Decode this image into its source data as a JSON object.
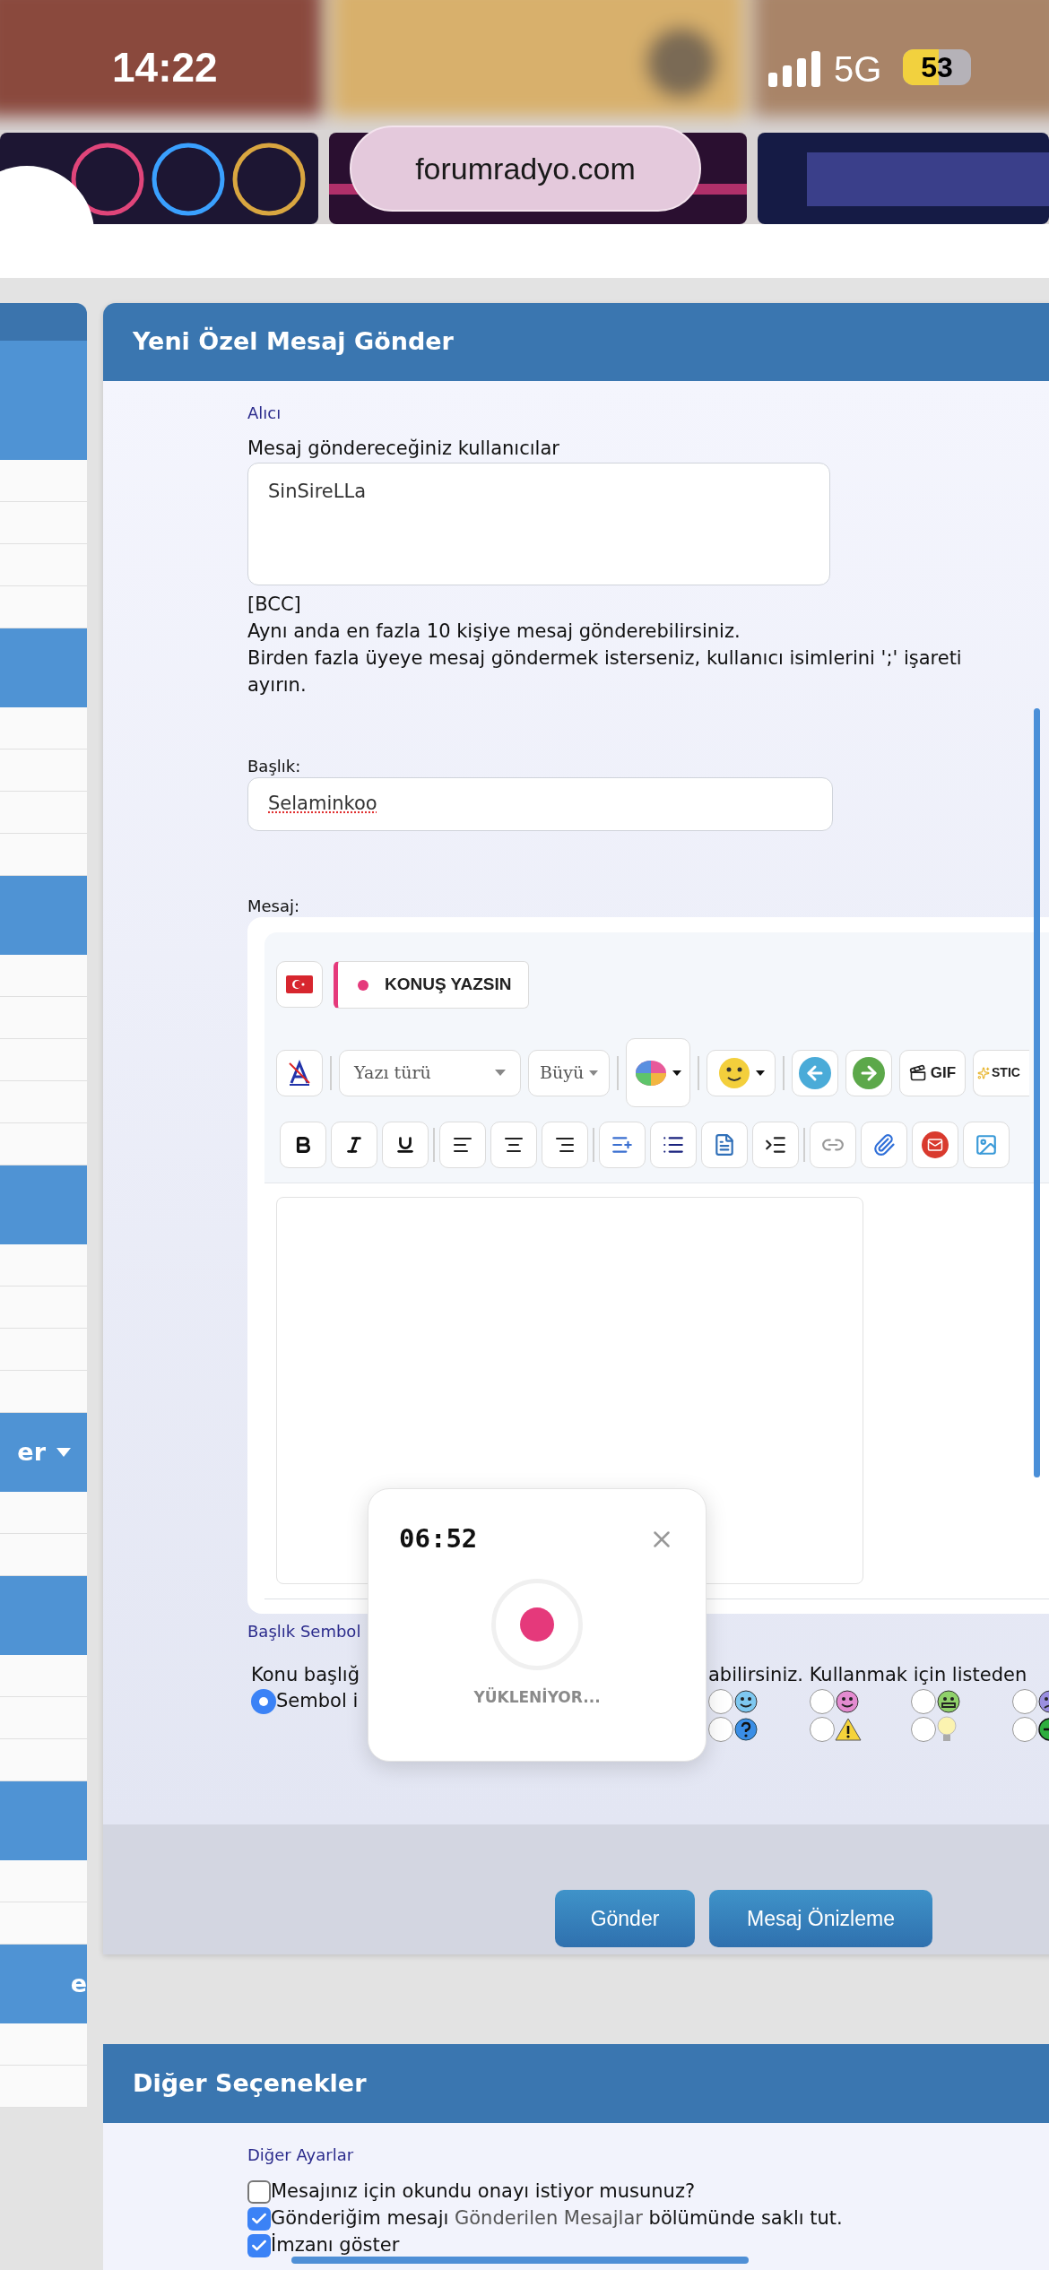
{
  "status_bar": {
    "time": "14:22",
    "network": "5G",
    "battery": "53"
  },
  "browser": {
    "url": "forumradyo.com"
  },
  "sidebar": {
    "headings": [
      {
        "label": "er",
        "kind": "menu"
      },
      {
        "label": "e",
        "kind": "plain"
      }
    ]
  },
  "compose": {
    "title": "Yeni Özel Mesaj Gönder",
    "recipient_section": "Alıcı",
    "recipients_label": "Mesaj göndereceğiniz kullanıcılar",
    "recipients_value": "SinSireLLa",
    "bcc": "[BCC]",
    "help_lines": [
      "Aynı anda en fazla 10 kişiye mesaj gönderebilirsiniz.",
      "Birden fazla üyeye mesaj göndermek isterseniz, kullanıcı isimlerini ';' işareti",
      "ayırın."
    ],
    "subject_label": "Başlık:",
    "subject_value": "Selaminkoo",
    "message_label": "Mesaj:",
    "editor": {
      "voice_button": "KONUŞ YAZSIN",
      "font_select": "Yazı türü",
      "size_select": "Büyü",
      "gif_button": "GIF",
      "sticker_button": "STIC"
    },
    "symbol_section": "Başlık Sembol",
    "symbol_help": [
      "Konu başlığ",
      "abilirsiniz. Kullanmak için listeden"
    ],
    "symbol_rows": [
      [
        {
          "kind": "text",
          "label": "Sembol i",
          "selected": true
        },
        {
          "kind": "wink",
          "selected": false
        },
        {
          "kind": "pink-smile",
          "selected": false
        },
        {
          "kind": "grin",
          "selected": false
        },
        {
          "kind": "sad",
          "selected": false
        }
      ],
      [
        {
          "kind": "question",
          "selected": false
        },
        {
          "kind": "warning",
          "selected": false
        },
        {
          "kind": "bulb",
          "selected": false
        },
        {
          "kind": "arrow",
          "selected": false
        }
      ]
    ],
    "buttons": [
      {
        "label": "Gönder"
      },
      {
        "label": "Mesaj Önizleme"
      }
    ]
  },
  "recorder": {
    "time": "06:52",
    "status": "YÜKLENİYOR..."
  },
  "other_options": {
    "title": "Diğer Seçenekler",
    "section": "Diğer Ayarlar",
    "options": [
      {
        "parts": [
          "Mesajınız için okundu onayı istiyor musunuz?"
        ],
        "checked": false
      },
      {
        "parts": [
          "Gönderiğim mesajı ",
          "Gönderilen Mesajlar",
          " bölümünde saklı tut."
        ],
        "checked": true
      },
      {
        "parts": [
          "İmzanı göster"
        ],
        "checked": true
      }
    ]
  }
}
